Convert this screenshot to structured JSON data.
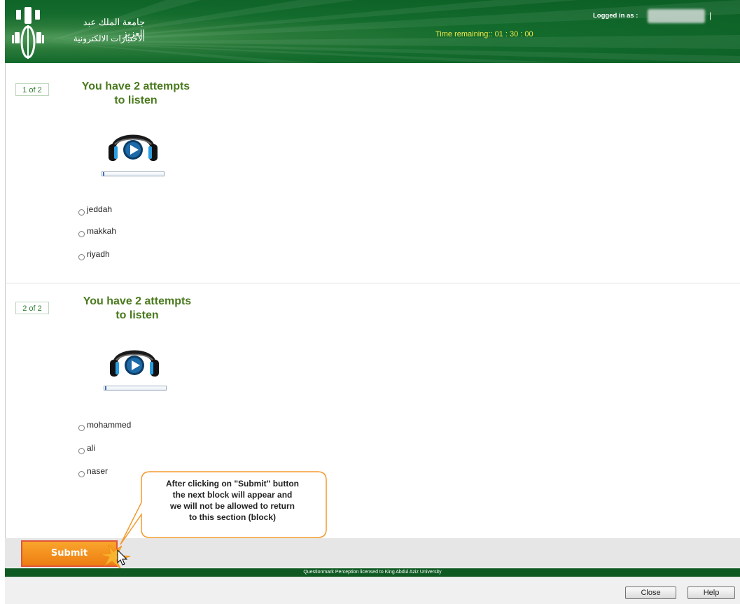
{
  "header": {
    "university_name": "جامعة الملك عبد العزيز",
    "system_name": "الاختبارات الالكترونية",
    "timer_text": "Time remaining:: 01 : 30 : 00",
    "logged_in_label": "Logged in as :",
    "separator": "|"
  },
  "questions": [
    {
      "number_label": "1 of 2",
      "title_line1": "You have 2 attempts",
      "title_line2": "to listen",
      "player_progress": 0,
      "options": [
        "jeddah",
        "makkah",
        "riyadh"
      ]
    },
    {
      "number_label": "2 of 2",
      "title_line1": "You have 2 attempts",
      "title_line2": "to listen",
      "player_progress": 0,
      "options": [
        "mohammed",
        "ali",
        "naser"
      ]
    }
  ],
  "callout": {
    "line1": "After clicking on \"Submit\" button",
    "line2": "the next block will appear and",
    "line3": "we will not be allowed to return",
    "line4": "to this section (block)"
  },
  "submit_label": "Submit",
  "footer_text": "Questionmark Perception licensed to King Abdul Aziz University",
  "bottom_buttons": {
    "close": "Close",
    "help": "Help"
  },
  "colors": {
    "header_green": "#0b5e25",
    "title_green": "#4a7a1e",
    "timer_yellow": "#f2e84a",
    "submit_orange": "#ee7d12",
    "callout_border": "#f39a2e"
  }
}
